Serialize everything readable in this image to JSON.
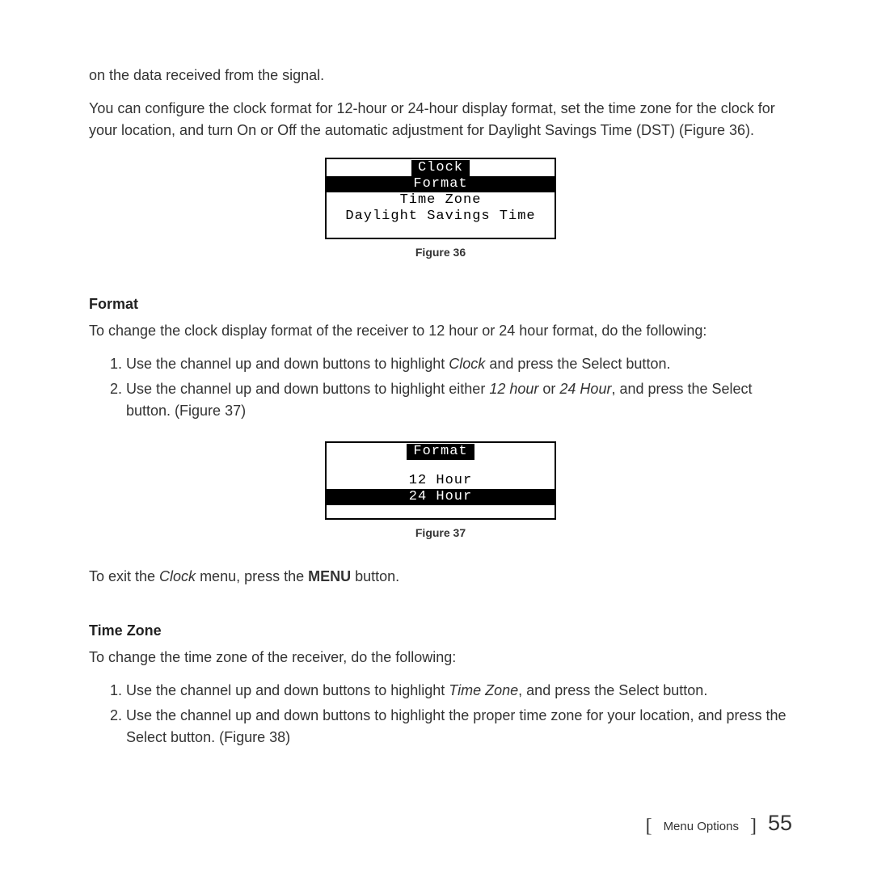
{
  "intro1": "on the data received from the signal.",
  "intro2_a": "You can configure the clock format for 12-hour or 24-hour display format, set the time zone for the clock for your location, and turn On or Off the automatic adjustment for Daylight Savings Time (DST) (Figure 36).",
  "fig36": {
    "title": "Clock",
    "rows": [
      "Format",
      "Time Zone",
      "Daylight Savings Time"
    ],
    "highlighted_index": 0,
    "caption": "Figure 36"
  },
  "format": {
    "heading": "Format",
    "lead_a": "To change the clock display format of the receiver to 12 hour or 24 hour format, do the following:",
    "step1_a": "Use the channel up and down buttons to highlight ",
    "step1_i": "Clock",
    "step1_b": " and press the Select button.",
    "step2_a": "Use the channel up and down buttons to highlight either ",
    "step2_i1": "12 hour",
    "step2_mid": " or ",
    "step2_i2": "24 Hour",
    "step2_b": ", and press the Select button. (Figure 37)"
  },
  "fig37": {
    "title": "Format",
    "rows": [
      "12 Hour",
      "24 Hour"
    ],
    "highlighted_index": 1,
    "caption": "Figure 37"
  },
  "exit_a": "To exit the ",
  "exit_i": "Clock",
  "exit_b": " menu, press the ",
  "exit_bold": "MENU",
  "exit_c": " button.",
  "timezone": {
    "heading": "Time Zone",
    "lead": "To change the time zone of the receiver, do the following:",
    "step1_a": "Use the channel up and down buttons to highlight ",
    "step1_i": "Time Zone",
    "step1_b": ", and press the Select button.",
    "step2": "Use the channel up and down buttons to highlight the proper time zone for your location, and press the Select button. (Figure 38)"
  },
  "footer": {
    "section": "Menu Options",
    "page": "55"
  }
}
